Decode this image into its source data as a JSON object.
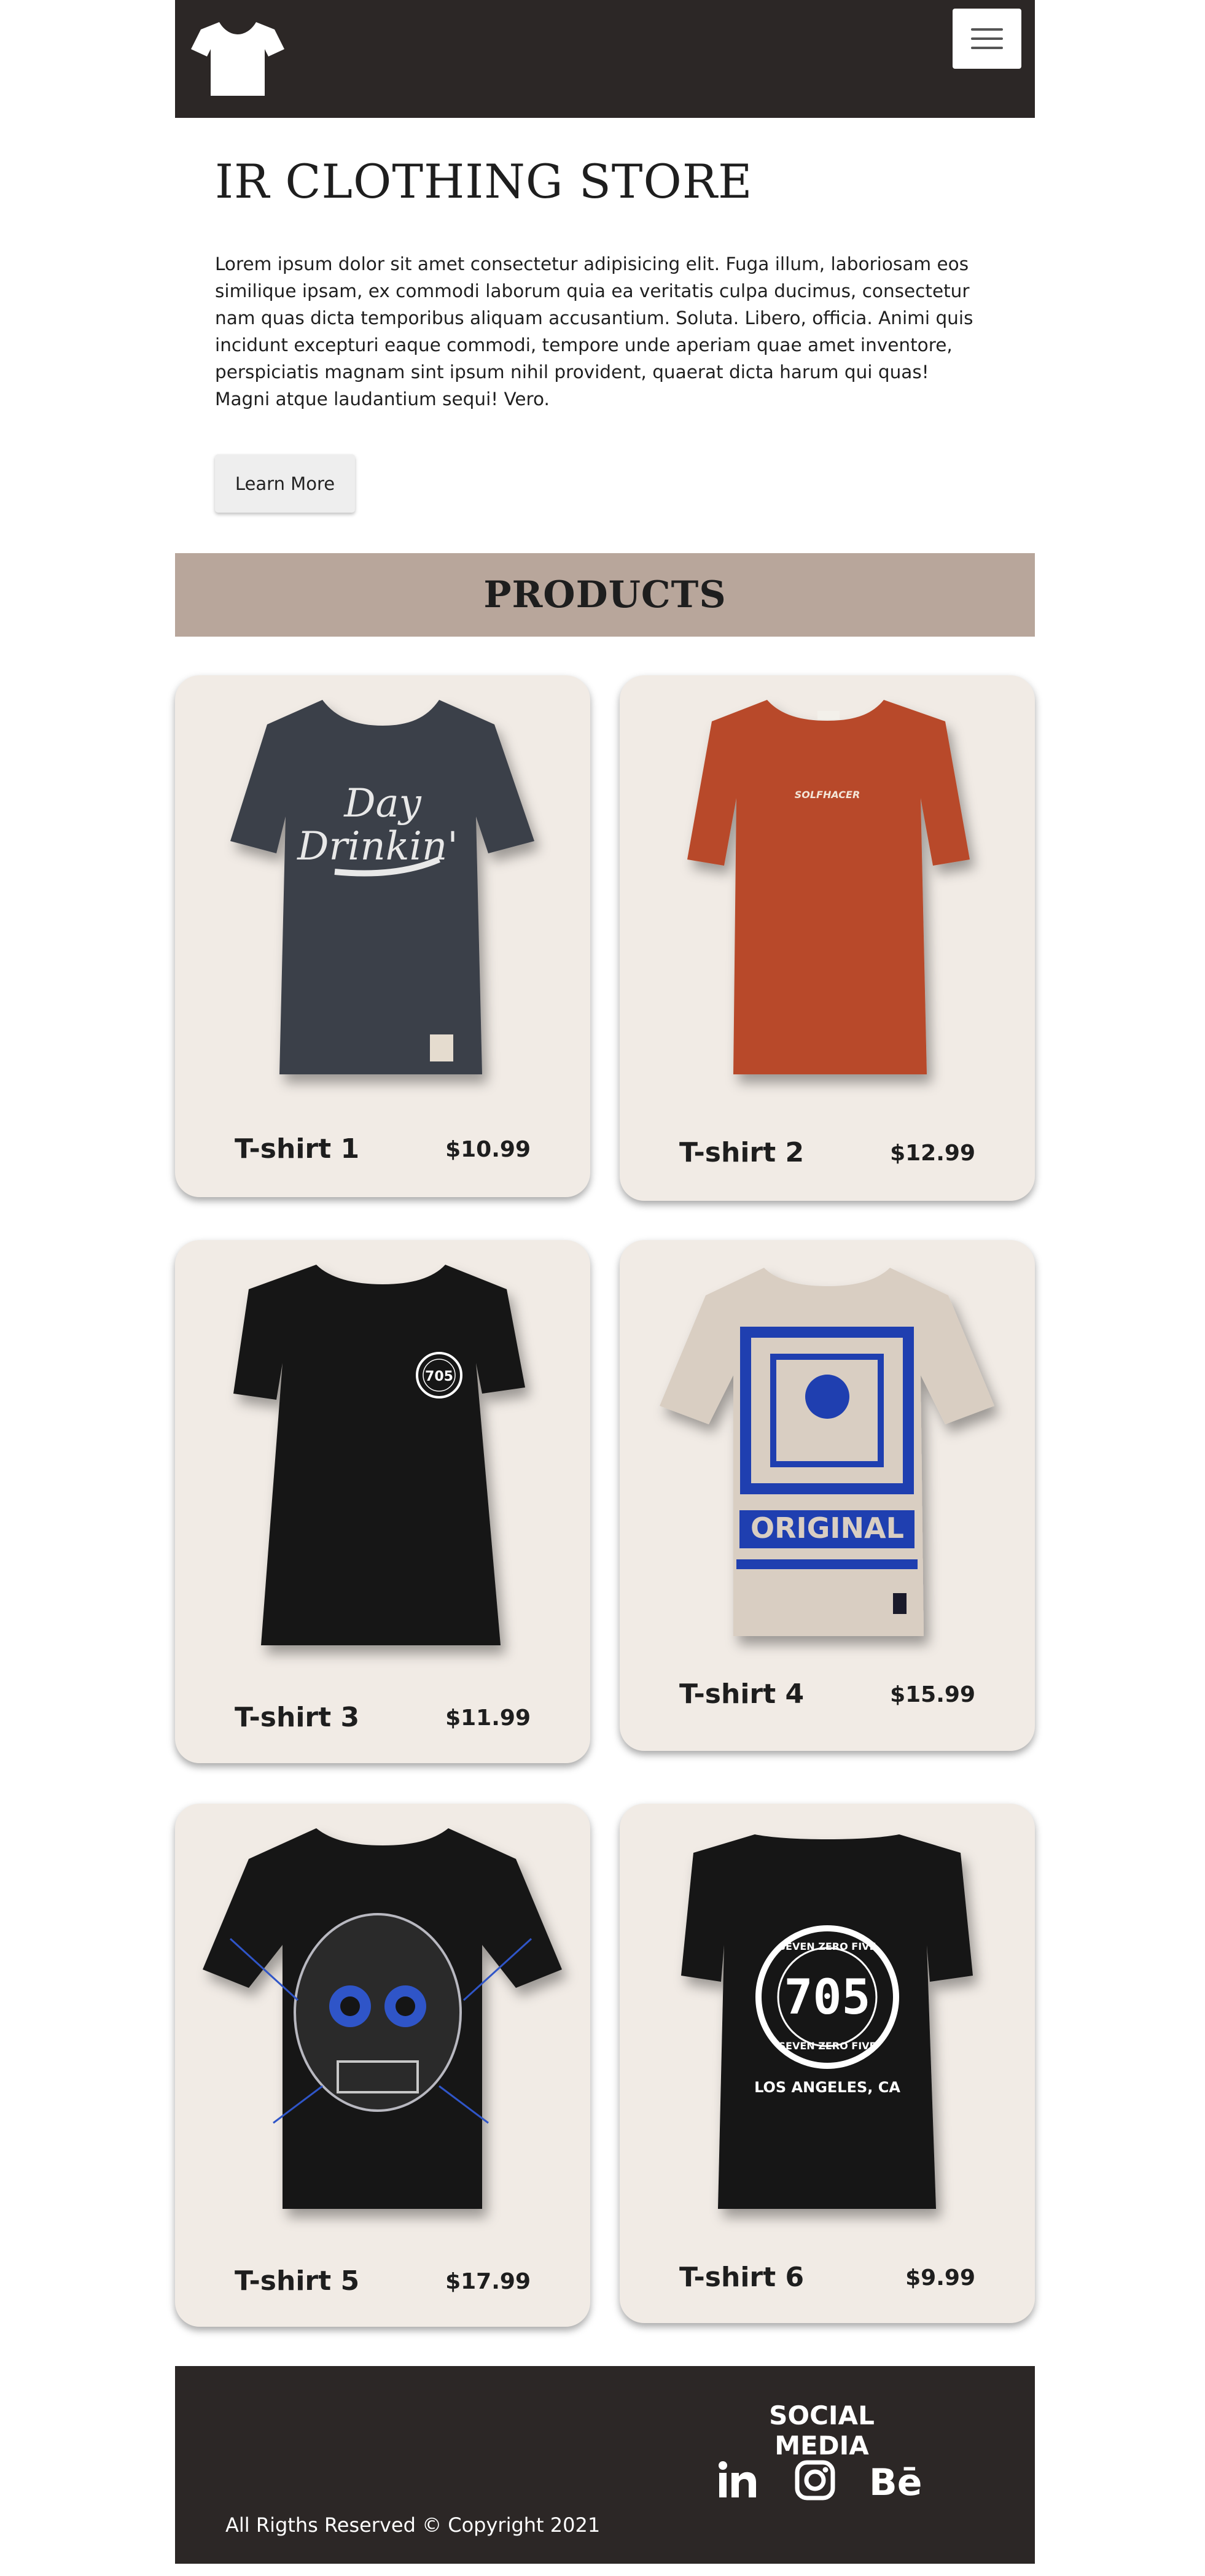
{
  "header": {
    "logo_icon": "t-shirt-icon",
    "menu_icon": "hamburger-menu-icon"
  },
  "hero": {
    "title": "IR CLOTHING STORE",
    "text": "Lorem ipsum dolor sit amet consectetur adipisicing elit. Fuga illum, laboriosam eos similique ipsam, ex commodi laborum quia ea veritatis culpa ducimus, consectetur nam quas dicta temporibus aliquam accusantium. Soluta. Libero, officia. Animi quis incidunt excepturi eaque commodi, tempore unde aperiam quae amet inventore, perspiciatis magnam sint ipsum nihil provident, quaerat dicta harum qui quas! Magni atque laudantium sequi! Vero.",
    "button_label": "Learn More"
  },
  "products": {
    "title": "PRODUCTS",
    "items": [
      {
        "name": "T-shirt 1",
        "price": "$10.99",
        "shirt_color": "#3a3f4a",
        "graphic": "Day Drinkin'"
      },
      {
        "name": "T-shirt 2",
        "price": "$12.99",
        "shirt_color": "#b84a2a",
        "graphic": "SOLFHACER"
      },
      {
        "name": "T-shirt 3",
        "price": "$11.99",
        "shirt_color": "#121212",
        "graphic": "705"
      },
      {
        "name": "T-shirt 4",
        "price": "$15.99",
        "shirt_color": "#d9cec2",
        "graphic": "ORIGINAL"
      },
      {
        "name": "T-shirt 5",
        "price": "$17.99",
        "shirt_color": "#151515",
        "graphic": "skull"
      },
      {
        "name": "T-shirt 6",
        "price": "$9.99",
        "shirt_color": "#121212",
        "graphic": "705"
      }
    ]
  },
  "footer": {
    "heading": "SOCIAL MEDIA",
    "social_icons": [
      "linkedin-icon",
      "instagram-icon",
      "behance-icon"
    ],
    "copyright": "All Rigths Reserved © Copyright 2021"
  },
  "colors": {
    "header_bg": "#2c2726",
    "banner_bg": "#b8a69b",
    "card_bg": "#f1ebe5",
    "footer_bg": "#2c2726"
  }
}
